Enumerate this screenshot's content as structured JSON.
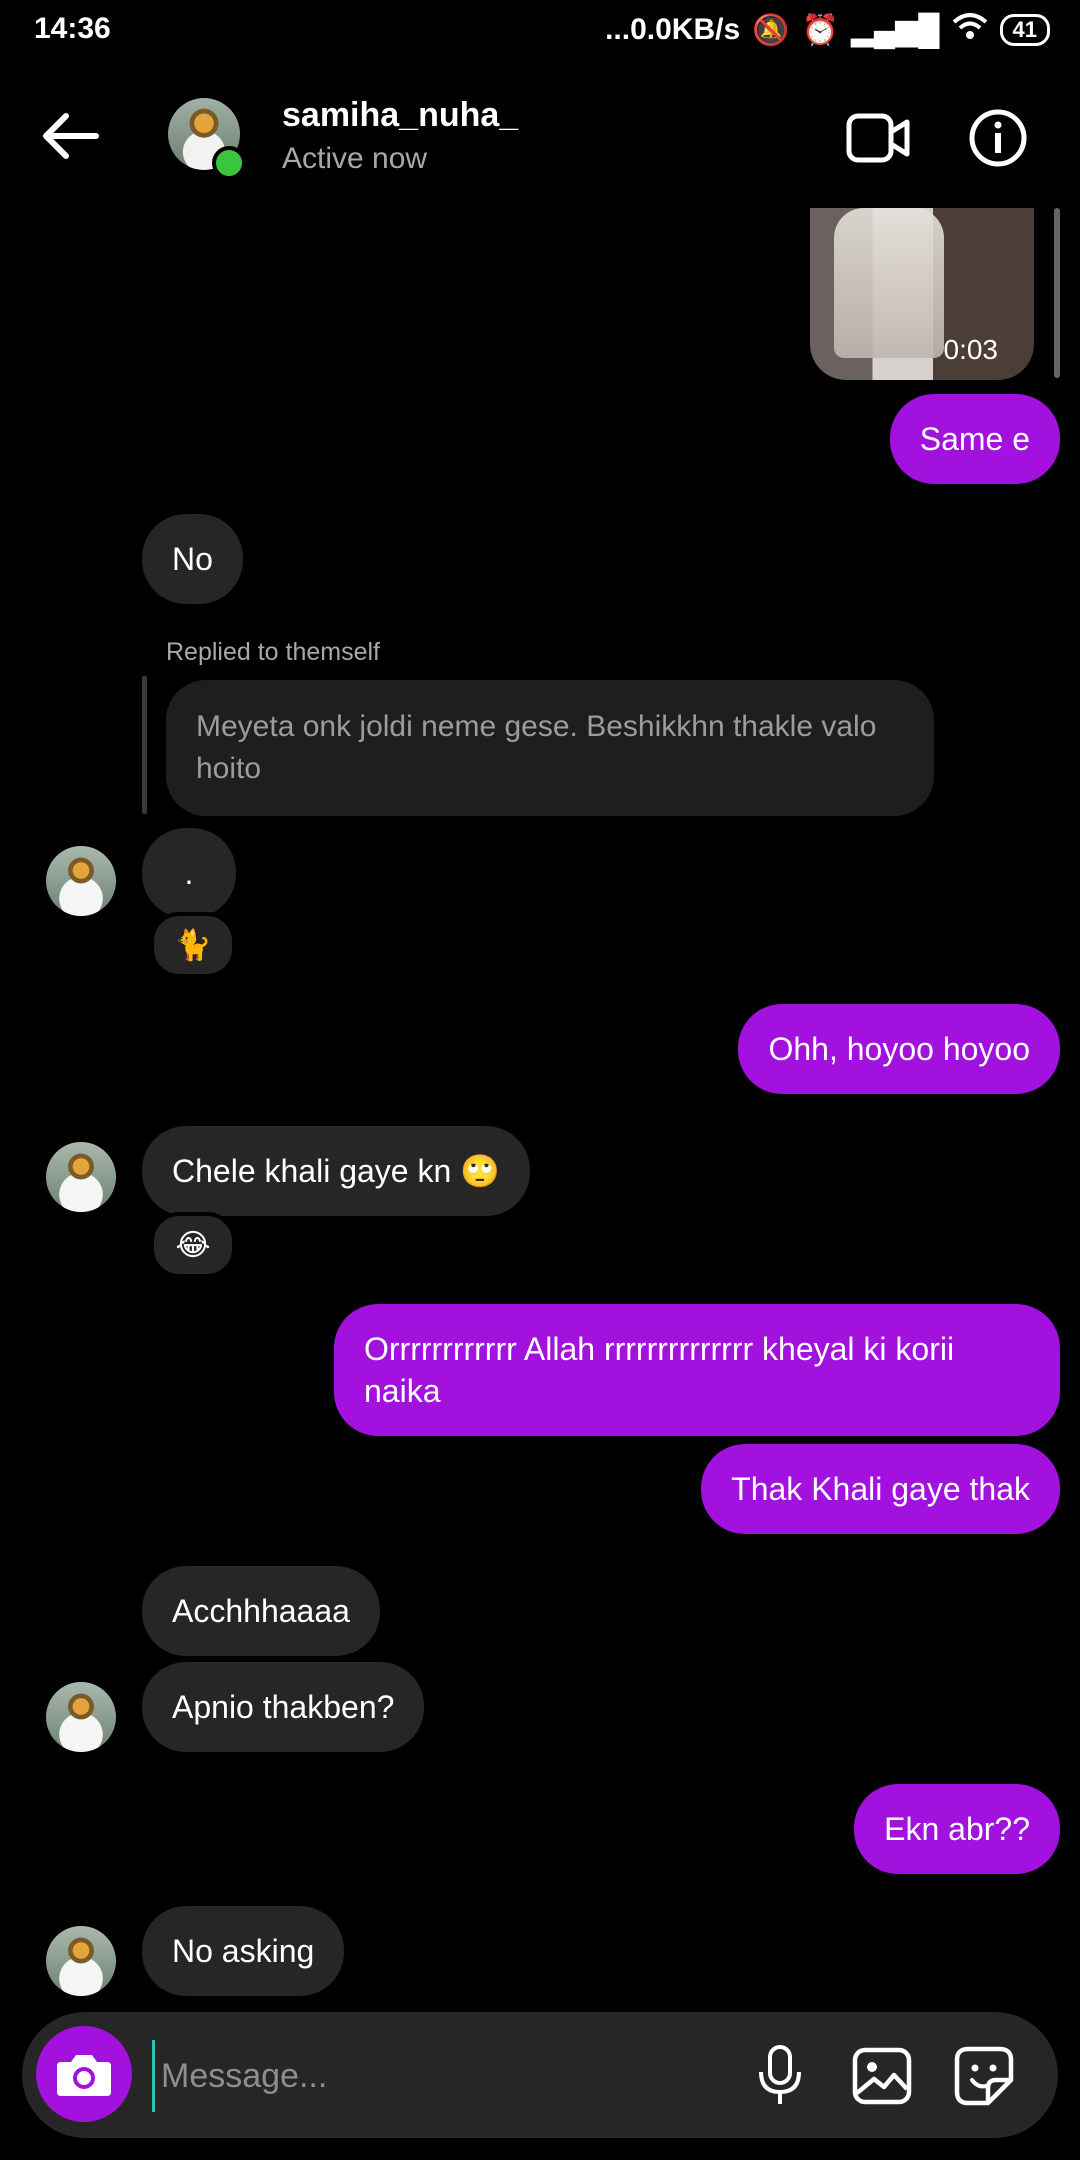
{
  "status_bar": {
    "time": "14:36",
    "network": "...0.0KB/s",
    "battery": "41"
  },
  "header": {
    "username": "samiha_nuha_",
    "status": "Active now",
    "back_icon": "back-arrow-icon",
    "video_icon": "video-call-icon",
    "info_icon": "info-icon"
  },
  "thumbnail": {
    "duration": "0:03"
  },
  "messages": [
    {
      "side": "out",
      "text": "Same e"
    },
    {
      "side": "in",
      "text": "No"
    },
    {
      "side": "in",
      "reply_label": "Replied to themself",
      "quoted": "Meyeta onk joldi neme gese. Beshikkhn thakle valo hoito"
    },
    {
      "side": "in",
      "text": ".",
      "reaction": "🐈"
    },
    {
      "side": "out",
      "text": "Ohh, hoyoo hoyoo"
    },
    {
      "side": "in",
      "text": "Chele khali gaye kn 🙄",
      "reaction": "😂"
    },
    {
      "side": "out",
      "text": "Orrrrrrrrrrrr Allah rrrrrrrrrrrrrr kheyal ki korii naika"
    },
    {
      "side": "out",
      "text": "Thak Khali gaye thak"
    },
    {
      "side": "in",
      "text": "Acchhhaaaa"
    },
    {
      "side": "in",
      "text": "Apnio thakben?"
    },
    {
      "side": "out",
      "text": "Ekn abr??"
    },
    {
      "side": "in",
      "text": "No asking"
    }
  ],
  "composer": {
    "placeholder": "Message...",
    "camera_icon": "camera-icon",
    "mic_icon": "microphone-icon",
    "gallery_icon": "gallery-icon",
    "sticker_icon": "sticker-icon"
  },
  "colors": {
    "outgoing": "#a211dd",
    "incoming": "#262626",
    "online": "#39c53e"
  }
}
